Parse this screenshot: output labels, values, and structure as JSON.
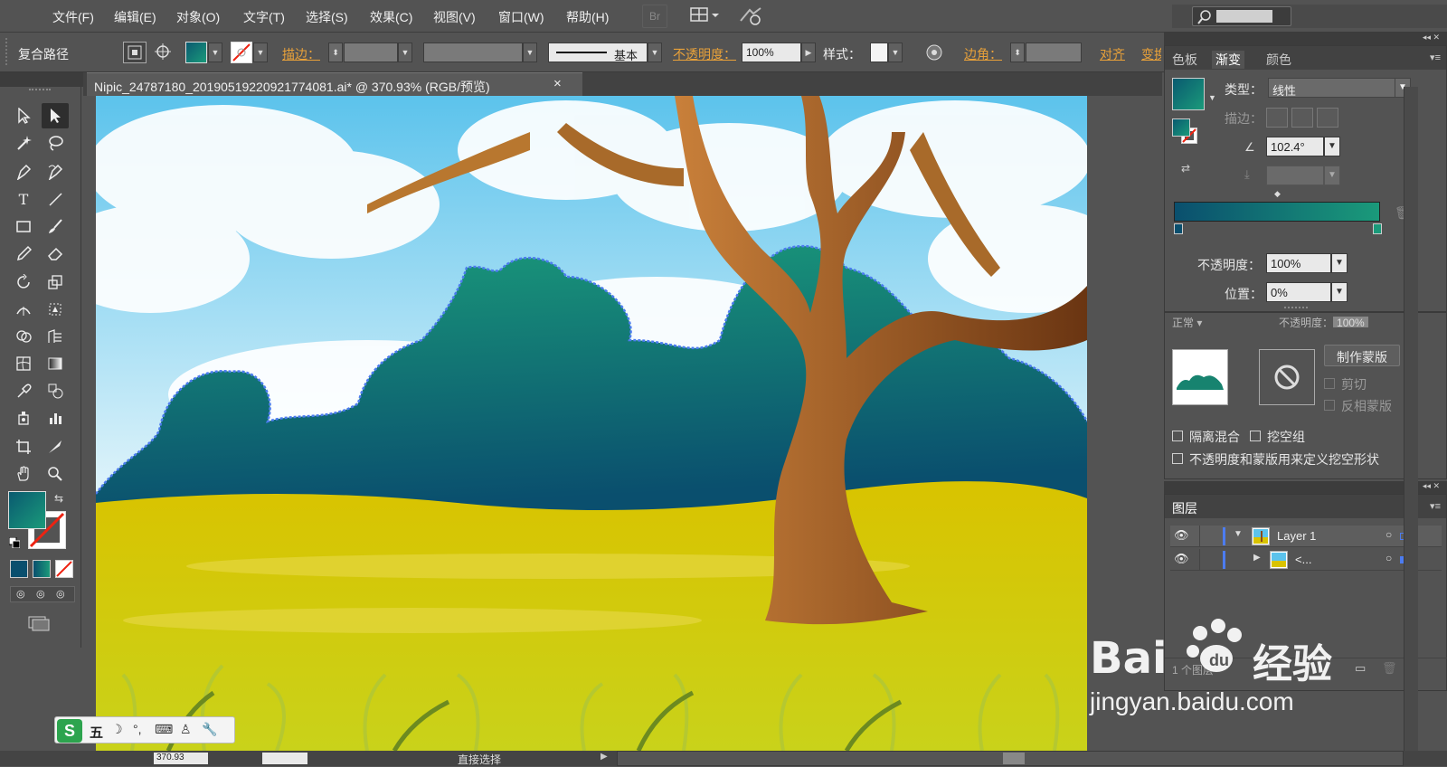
{
  "menu": {
    "items": [
      "文件(F)",
      "编辑(E)",
      "对象(O)",
      "文字(T)",
      "选择(S)",
      "效果(C)",
      "视图(V)",
      "窗口(W)",
      "帮助(H)"
    ],
    "br_label": "Br"
  },
  "control_bar": {
    "selection_label": "复合路径",
    "stroke_label": "描边：",
    "stroke_style_label": "基本",
    "opacity_label": "不透明度：",
    "opacity_value": "100%",
    "style_label": "样式：",
    "corner_label": "边角：",
    "align_label": "对齐",
    "transform_label": "变换"
  },
  "document": {
    "tab_title": "Nipic_24787180_20190519220921774081.ai* @ 370.93% (RGB/预览)",
    "close_glyph": "×"
  },
  "gradient_panel": {
    "tabs": [
      "色板",
      "渐变",
      "颜色"
    ],
    "active_tab": "渐变",
    "type_label": "类型：",
    "type_value": "线性",
    "stroke_label": "描边：",
    "angle_value": "102.4°",
    "opacity_label": "不透明度：",
    "opacity_value": "100%",
    "position_label": "位置：",
    "position_value": "0%",
    "gradient_start": "#0a4f6e",
    "gradient_end": "#1a9a7a"
  },
  "transparency_panel": {
    "mode_value": "正常",
    "opacity_label": "不透明度：",
    "opacity_value": "100%",
    "make_mask_button": "制作蒙版",
    "clip_label": "剪切",
    "invert_label": "反相蒙版",
    "isolate_label": "隔离混合",
    "knockout_label": "挖空组",
    "opacity_mask_label": "不透明度和蒙版用来定义挖空形状"
  },
  "layers_panel": {
    "title": "图层",
    "layer1_name": "Layer 1",
    "sublayer_name": "<...",
    "count_label": "1 个图层"
  },
  "status_bar": {
    "zoom_value": "370.93",
    "tool_label": "直接选择"
  },
  "ime": {
    "label": "五"
  },
  "watermark": {
    "brand": "Bai",
    "brand2": "经验",
    "url": "jingyan.baidu.com"
  }
}
